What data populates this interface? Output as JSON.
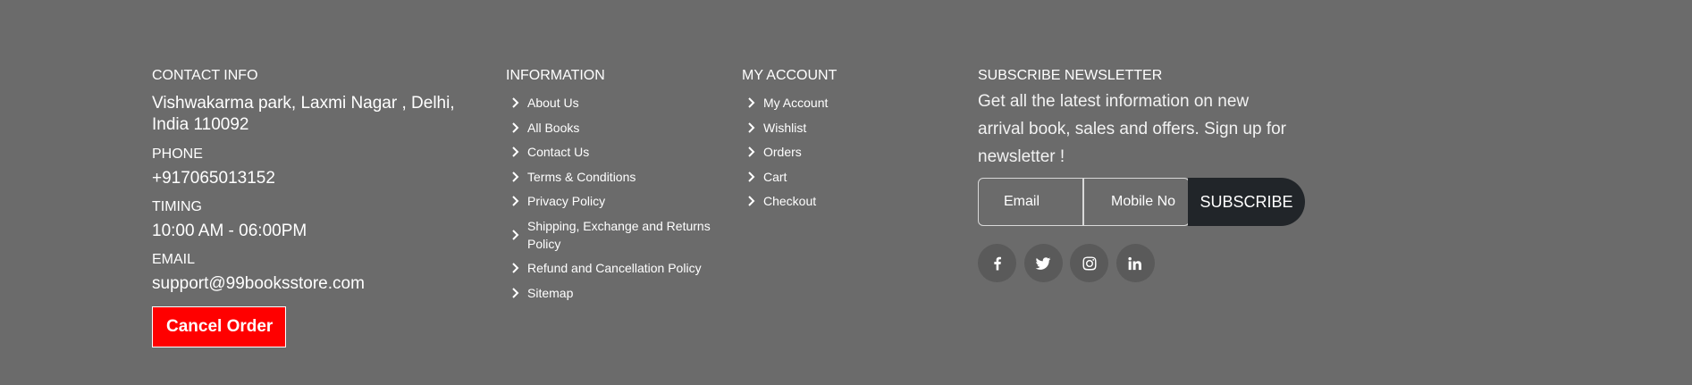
{
  "contact": {
    "heading": "CONTACT INFO",
    "address": "Vishwakarma park, Laxmi Nagar , Delhi, India 110092",
    "phone_label": "PHONE",
    "phone": "+917065013152",
    "timing_label": "TIMING",
    "timing": "10:00 AM - 06:00PM",
    "email_label": "EMAIL",
    "email": "support@99booksstore.com",
    "cancel_button": "Cancel Order"
  },
  "information": {
    "heading": "INFORMATION",
    "items": [
      "About Us",
      "All Books",
      "Contact Us",
      "Terms & Conditions",
      "Privacy Policy",
      "Shipping, Exchange and Returns Policy",
      "Refund and Cancellation Policy",
      "Sitemap"
    ]
  },
  "account": {
    "heading": "MY ACCOUNT",
    "items": [
      "My Account",
      "Wishlist",
      "Orders",
      "Cart",
      "Checkout"
    ]
  },
  "newsletter": {
    "heading": "SUBSCRIBE NEWSLETTER",
    "text": "Get all the latest information on new arrival book, sales and offers. Sign up for newsletter !",
    "email_placeholder": "Email",
    "mobile_placeholder": "Mobile No",
    "subscribe_button": "SUBSCRIBE",
    "social": [
      "facebook-icon",
      "twitter-icon",
      "instagram-icon",
      "linkedin-icon"
    ]
  },
  "colors": {
    "background": "#6b6b6b",
    "cancel_button": "#ff0000",
    "subscribe_button": "#212529",
    "social_circle": "#5a5a5a"
  }
}
